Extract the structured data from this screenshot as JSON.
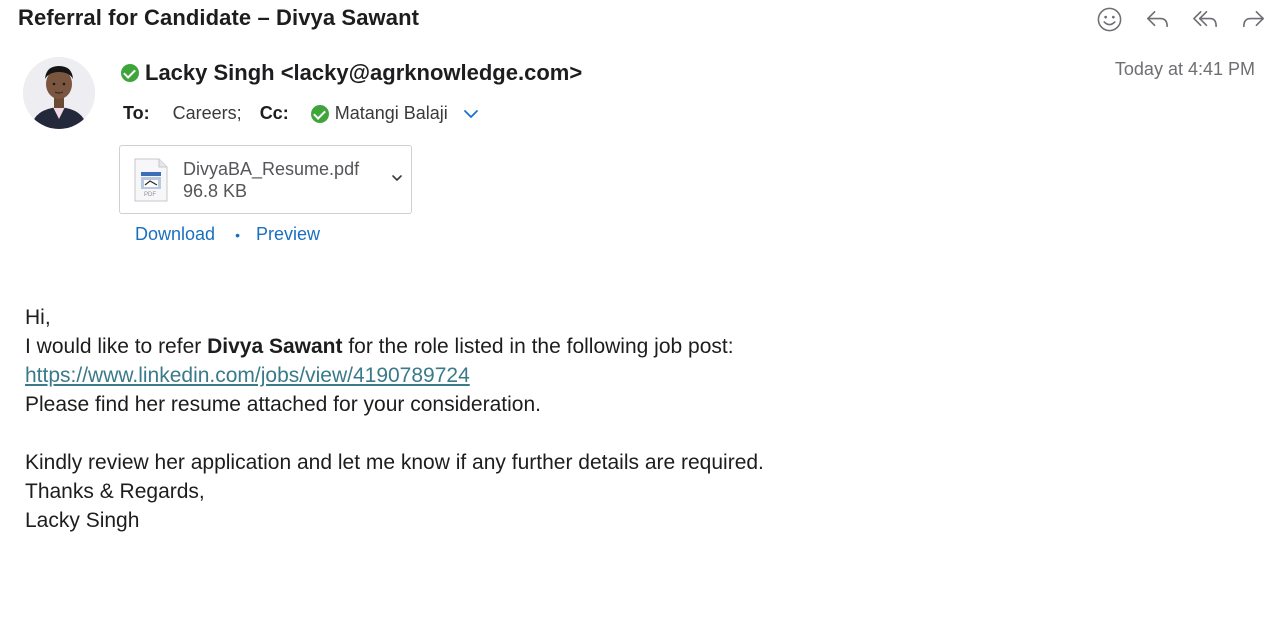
{
  "email": {
    "subject": "Referral for Candidate – Divya Sawant",
    "sender": "Lacky Singh <lacky@agrknowledge.com>",
    "timestamp": "Today at 4:41 PM",
    "to_label": "To:",
    "to_value": "Careers;",
    "cc_label": "Cc:",
    "cc_value": "Matangi Balaji"
  },
  "toolbar": {
    "icons": [
      "emoji-icon",
      "reply-icon",
      "reply-all-icon",
      "forward-icon"
    ]
  },
  "attachment": {
    "filename": "DivyaBA_Resume.pdf",
    "size": "96.8 KB",
    "type_label": "PDF",
    "download_label": "Download",
    "separator": "•",
    "preview_label": "Preview"
  },
  "body": {
    "greeting": "Hi,",
    "line1_pre": "I would like to refer ",
    "line1_bold": "Divya Sawant",
    "line1_post": " for the role listed in the following job post:",
    "link": "https://www.linkedin.com/jobs/view/4190789724",
    "line2": "Please find her resume attached for your consideration.",
    "line3": "Kindly review her application and let me know if any further details are required.",
    "line4": "Thanks & Regards,",
    "line5": "Lacky Singh"
  },
  "colors": {
    "accent_blue": "#1a6fc0",
    "online_green": "#3fa53a",
    "link_teal": "#3a7a8a",
    "muted_gray": "#6e6e73"
  }
}
